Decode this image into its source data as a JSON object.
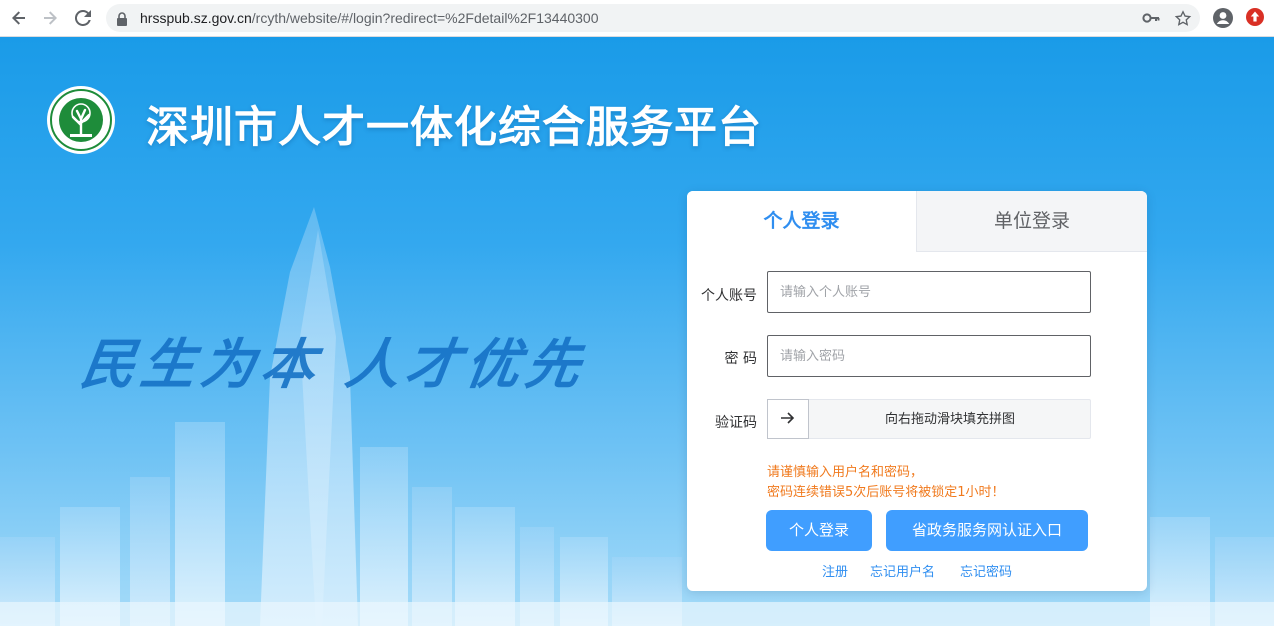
{
  "browser": {
    "url_host": "hrsspub.sz.gov.cn",
    "url_path": "/rcyth/website/#/login?redirect=%2Fdetail%2F13440300"
  },
  "page": {
    "title": "深圳市人才一体化综合服务平台",
    "slogan": "民生为本 人才优先"
  },
  "login": {
    "tabs": [
      {
        "label": "个人登录",
        "active": true
      },
      {
        "label": "单位登录",
        "active": false
      }
    ],
    "account": {
      "label": "个人账号",
      "placeholder": "请输入个人账号",
      "value": ""
    },
    "password": {
      "label": "密 码",
      "placeholder": "请输入密码",
      "value": ""
    },
    "captcha": {
      "label": "验证码",
      "slider_text": "向右拖动滑块填充拼图"
    },
    "warning_line1": "请谨慎输入用户名和密码，",
    "warning_line2": "密码连续错误5次后账号将被锁定1小时！",
    "login_button": "个人登录",
    "gov_button": "省政务服务网认证入口",
    "links": {
      "register": "注册",
      "forgot_username": "忘记用户名",
      "forgot_password": "忘记密码"
    }
  },
  "colors": {
    "primary": "#409eff",
    "tab_active": "#2f8ef0",
    "warning": "#f07a1e",
    "banner_top": "#1a9be8"
  },
  "icons": [
    "back-icon",
    "forward-icon",
    "reload-icon",
    "lock-icon",
    "key-icon",
    "star-icon",
    "account-icon",
    "extension-icon",
    "arrow-right-icon"
  ]
}
